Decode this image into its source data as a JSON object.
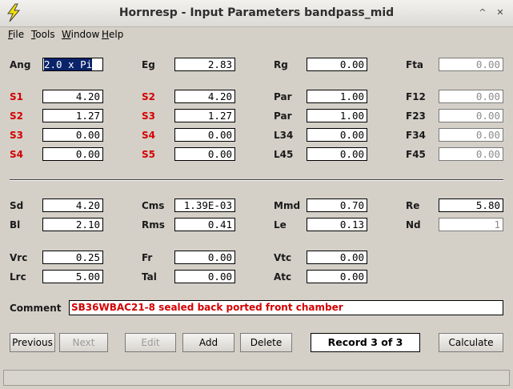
{
  "window": {
    "title": "Hornresp - Input Parameters   bandpass_mid"
  },
  "menu": [
    "File",
    "Tools",
    "Window",
    "Help"
  ],
  "labels": {
    "ang": "Ang",
    "eg": "Eg",
    "rg": "Rg",
    "fta": "Fta",
    "s1": "S1",
    "s2a": "S2",
    "par1": "Par",
    "f12": "F12",
    "s2": "S2",
    "s3a": "S3",
    "par2": "Par",
    "f23": "F23",
    "s3": "S3",
    "s4a": "S4",
    "l34": "L34",
    "f34": "F34",
    "s4": "S4",
    "s5": "S5",
    "l45": "L45",
    "f45": "F45",
    "sd": "Sd",
    "cms": "Cms",
    "mmd": "Mmd",
    "re": "Re",
    "bl": "Bl",
    "rms": "Rms",
    "le": "Le",
    "nd": "Nd",
    "vrc": "Vrc",
    "fr": "Fr",
    "vtc": "Vtc",
    "lrc": "Lrc",
    "tal": "Tal",
    "atc": "Atc",
    "comment": "Comment"
  },
  "values": {
    "ang": "2.0 x Pi",
    "eg": "2.83",
    "rg": "0.00",
    "fta": "0.00",
    "s1": "4.20",
    "s2a": "4.20",
    "par1": "1.00",
    "f12": "0.00",
    "s2": "1.27",
    "s3a": "1.27",
    "par2": "1.00",
    "f23": "0.00",
    "s3": "0.00",
    "s4a": "0.00",
    "l34": "0.00",
    "f34": "0.00",
    "s4": "0.00",
    "s5": "0.00",
    "l45": "0.00",
    "f45": "0.00",
    "sd": "4.20",
    "cms": "1.39E-03",
    "mmd": "0.70",
    "re": "5.80",
    "bl": "2.10",
    "rms": "0.41",
    "le": "0.13",
    "nd": "1",
    "vrc": "0.25",
    "fr": "0.00",
    "vtc": "0.00",
    "lrc": "5.00",
    "tal": "0.00",
    "atc": "0.00",
    "comment": "SB36WBAC21-8 sealed back ported front chamber"
  },
  "buttons": {
    "previous": "Previous",
    "next": "Next",
    "edit": "Edit",
    "add": "Add",
    "delete": "Delete",
    "record": "Record 3 of 3",
    "calculate": "Calculate"
  },
  "colors": {
    "red_label": "#d40000",
    "background": "#d4d0c8",
    "selection": "#0a246a"
  }
}
